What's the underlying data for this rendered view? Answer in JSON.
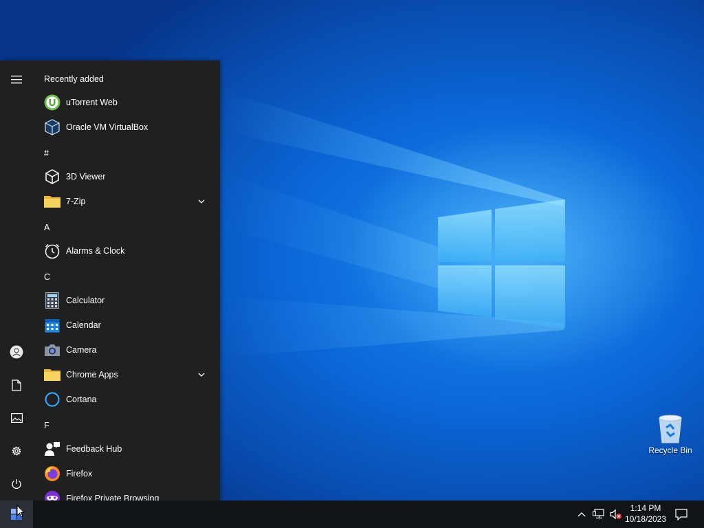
{
  "start_menu": {
    "rail": {
      "expand": "hamburger-icon",
      "account": "user-icon",
      "documents": "document-icon",
      "pictures": "pictures-icon",
      "settings": "gear-icon",
      "power": "power-icon"
    },
    "sections": [
      {
        "heading": "Recently added",
        "items": [
          {
            "label": "uTorrent Web",
            "icon": "utorrent-icon"
          },
          {
            "label": "Oracle VM VirtualBox",
            "icon": "virtualbox-icon"
          }
        ]
      },
      {
        "heading": "#",
        "items": [
          {
            "label": "3D Viewer",
            "icon": "cube-icon"
          },
          {
            "label": "7-Zip",
            "icon": "folder-icon",
            "expandable": true
          }
        ]
      },
      {
        "heading": "A",
        "items": [
          {
            "label": "Alarms & Clock",
            "icon": "alarm-clock-icon"
          }
        ]
      },
      {
        "heading": "C",
        "items": [
          {
            "label": "Calculator",
            "icon": "calculator-icon"
          },
          {
            "label": "Calendar",
            "icon": "calendar-icon"
          },
          {
            "label": "Camera",
            "icon": "camera-icon"
          },
          {
            "label": "Chrome Apps",
            "icon": "folder-icon",
            "expandable": true
          },
          {
            "label": "Cortana",
            "icon": "cortana-icon"
          }
        ]
      },
      {
        "heading": "F",
        "items": [
          {
            "label": "Feedback Hub",
            "icon": "feedback-icon"
          },
          {
            "label": "Firefox",
            "icon": "firefox-icon"
          },
          {
            "label": "Firefox Private Browsing",
            "icon": "firefox-private-icon"
          }
        ]
      }
    ]
  },
  "taskbar": {
    "start": "windows-logo-icon",
    "tray": {
      "show_hidden": "chevron-up-icon",
      "network": "network-icon",
      "volume": "volume-muted-icon",
      "notifications": "action-center-icon"
    },
    "time": "1:14 PM",
    "date": "10/18/2023"
  },
  "desktop": {
    "recycle_bin": "Recycle Bin"
  },
  "colors": {
    "menu_bg": "#202020",
    "taskbar_bg": "#101418",
    "desktop_blue": "#0b66d6"
  }
}
